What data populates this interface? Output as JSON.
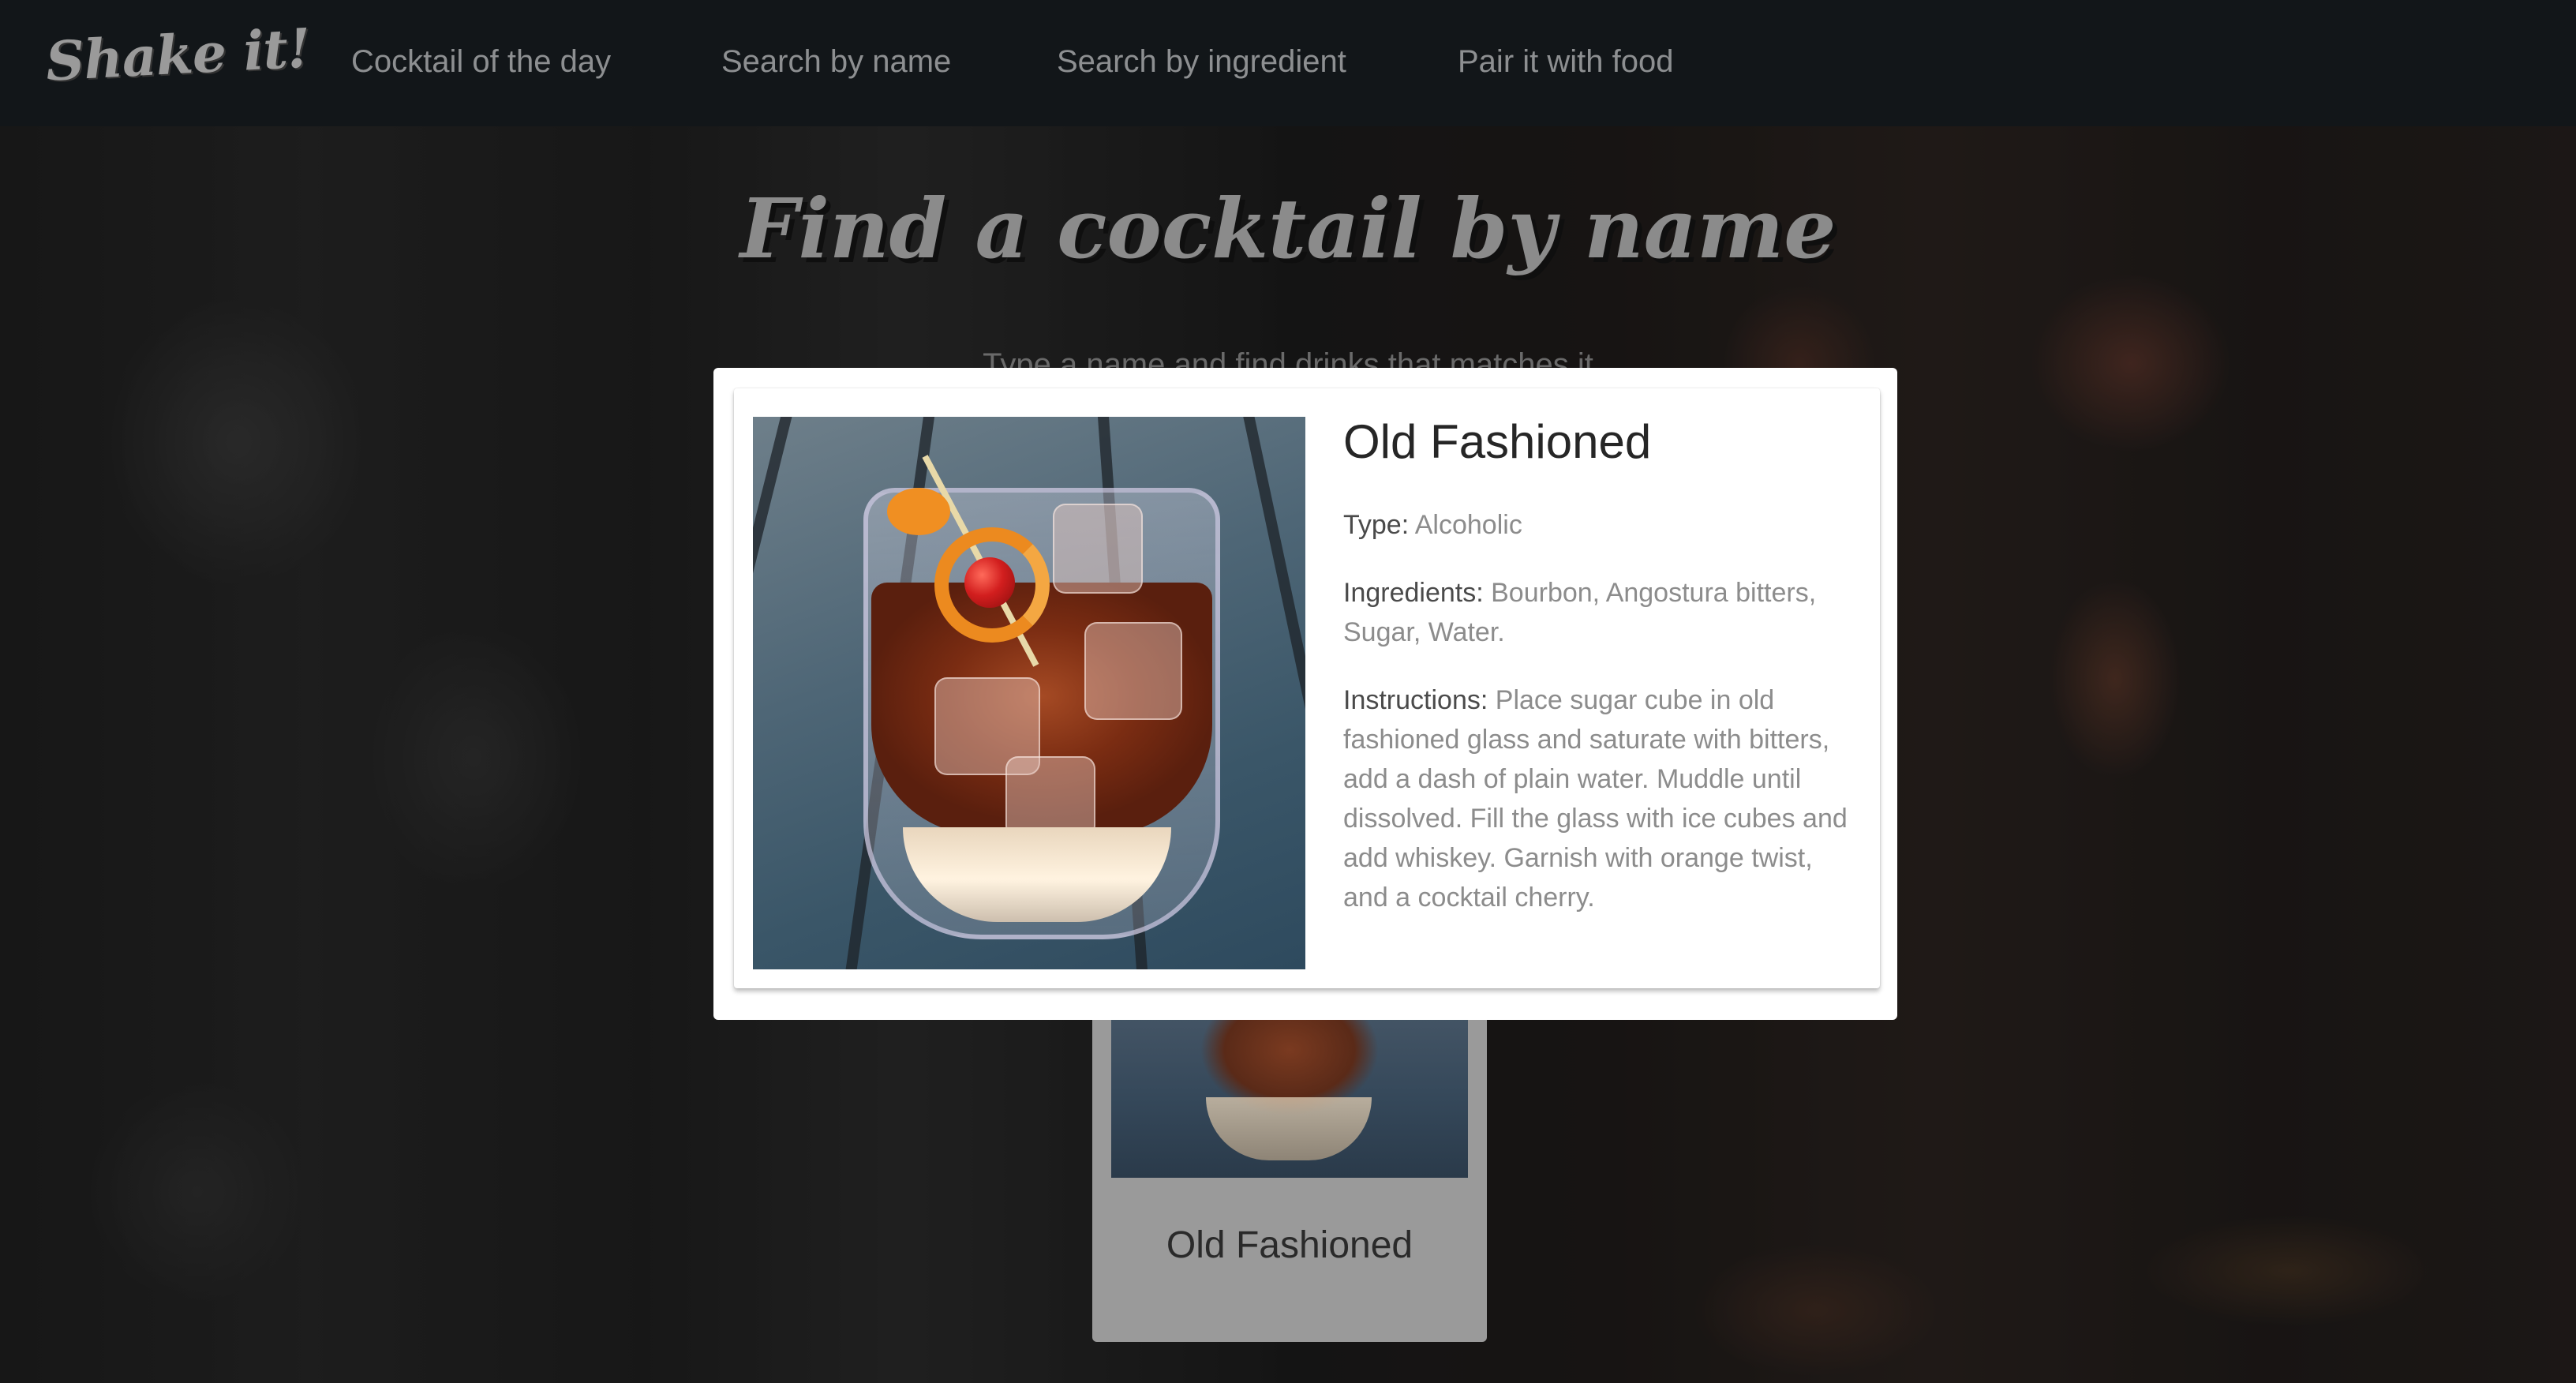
{
  "navbar": {
    "brand": "Shake it!",
    "items": [
      {
        "label": "Cocktail of the day"
      },
      {
        "label": "Search by name"
      },
      {
        "label": "Search by ingredient"
      },
      {
        "label": "Pair it with food"
      }
    ]
  },
  "main": {
    "title": "Find a cocktail by name",
    "subtitle": "Type a name and find drinks that matches it"
  },
  "results": [
    {
      "name": "Old Fashioned"
    }
  ],
  "modal": {
    "name": "Old Fashioned",
    "type_label": "Type:",
    "type_value": "Alcoholic",
    "ingredients_label": "Ingredients:",
    "ingredients_value": "Bourbon, Angostura bitters, Sugar, Water.",
    "instructions_label": "Instructions:",
    "instructions_value": "Place sugar cube in old fashioned glass and saturate with bitters, add a dash of plain water. Muddle until dissolved. Fill the glass with ice cubes and add whiskey. Garnish with orange twist, and a cocktail cherry."
  },
  "colors": {
    "navbar_bg": "#121619",
    "nav_text": "#8d8f91",
    "modal_bg": "#ffffff",
    "label_text": "#4a4a4a",
    "value_text": "#8c8c8c"
  }
}
